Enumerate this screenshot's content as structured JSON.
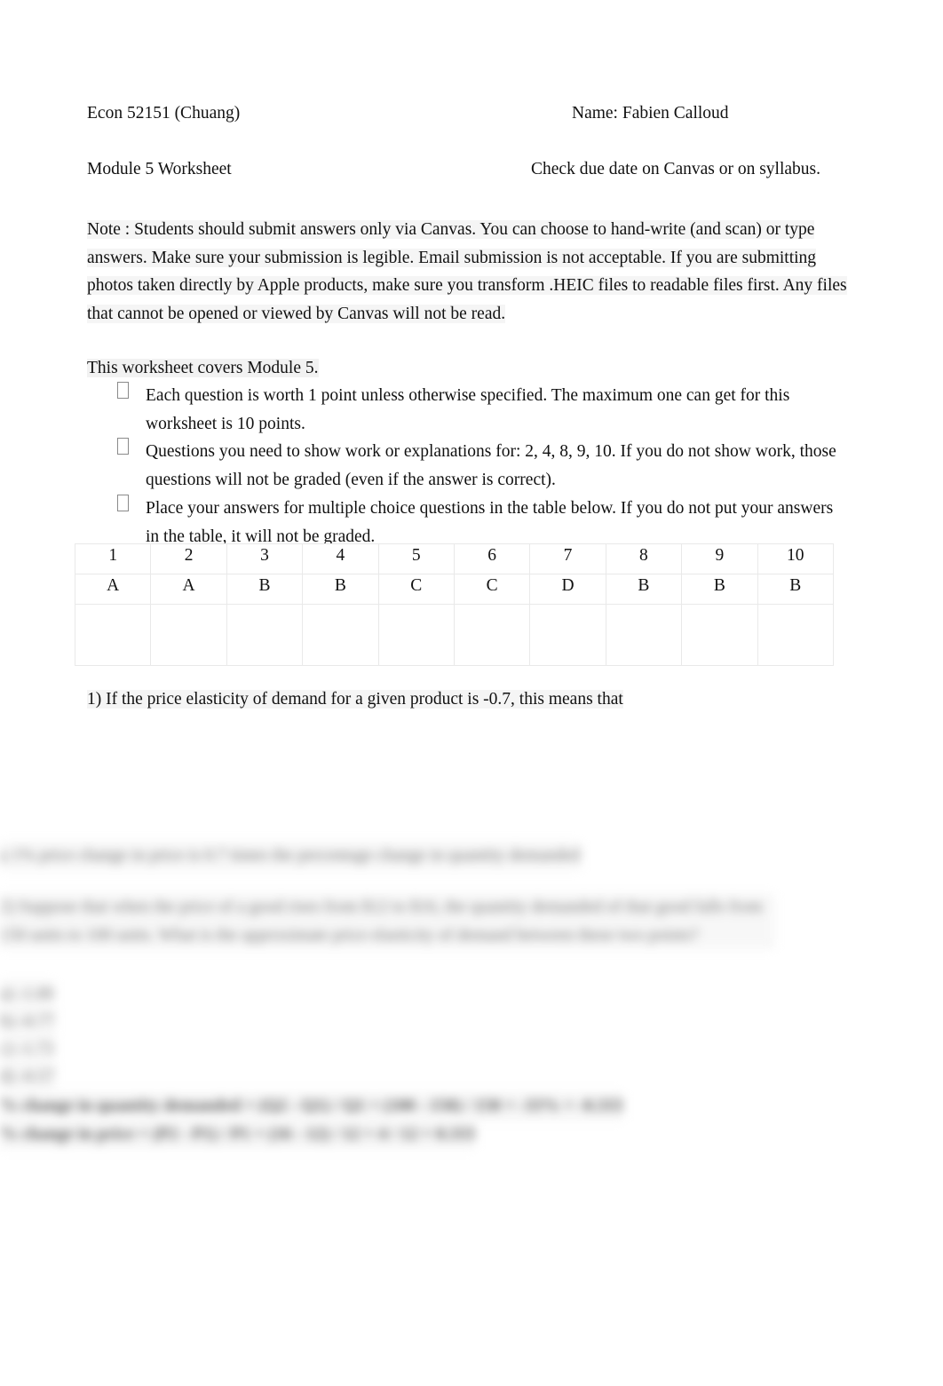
{
  "document": {
    "type": "worksheet",
    "page_background": "#ffffff",
    "text_color": "#111111",
    "highlight_color": "#f2f2f2",
    "table_border_color": "#e9e9e9"
  },
  "header": {
    "course": "Econ 52151 (Chuang)",
    "name": "Name: Fabien Calloud",
    "title": "Module 5 Worksheet",
    "due_note": "Check due date on Canvas or on syllabus."
  },
  "note": {
    "label": "Note",
    "text": "Note : Students should submit answers only via Canvas. You can choose to hand-write (and scan) or type answers. Make sure your submission is legible. Email submission is not acceptable. If you are submitting photos taken directly by Apple products, make sure you transform .HEIC files to readable files first. Any files that cannot be opened or viewed by Canvas will not be read."
  },
  "covers": {
    "text": "This worksheet covers Module 5."
  },
  "instructions": {
    "bullet_glyph": "notdef-box",
    "items": [
      "Each question is worth 1 point unless otherwise specified. The maximum one can get for this worksheet is 10 points.",
      "Questions you need to show work or explanations for: 2, 4, 8, 9, 10. If you do not show work, those questions will not be graded (even if the answer is correct).",
      "Place your answers for multiple choice questions in the table below. If you do not put your answers in the table, it will not be graded."
    ]
  },
  "answer_table": {
    "question_numbers": [
      "1",
      "2",
      "3",
      "4",
      "5",
      "6",
      "7",
      "8",
      "9",
      "10"
    ],
    "answers": [
      "A",
      "A",
      "B",
      "B",
      "C",
      "C",
      "D",
      "B",
      "B",
      "B"
    ],
    "blank_row": [
      "",
      "",
      "",
      "",
      "",
      "",
      "",
      "",
      "",
      ""
    ]
  },
  "question_1": {
    "text": "1) If the price elasticity of demand for a given product is -0.7, this means that"
  },
  "redacted": {
    "note": "lower portion of the page is blurred/illegible",
    "line_1": "a 1% price change in price is 0.7 times the percentage change in quantity demanded",
    "paragraph": "2) Suppose that when the price of a good rises from $12 to $16, the quantity demanded of that good falls from 150 units to 100 units. What is the approximate price elasticity of demand between these two points?",
    "options": [
      "a) -1.00",
      "b) -0.77",
      "c) -1.73",
      "d) -0.57"
    ],
    "work_line_1": "% change in quantity demanded = (Q2 - Q1) / Q1 = (100 - 150) / 150 = -33% = -0.333",
    "work_line_2": "% change in price = (P2 - P1) / P1 = (16 - 12) / 12 = 4 / 12 = 0.333"
  }
}
